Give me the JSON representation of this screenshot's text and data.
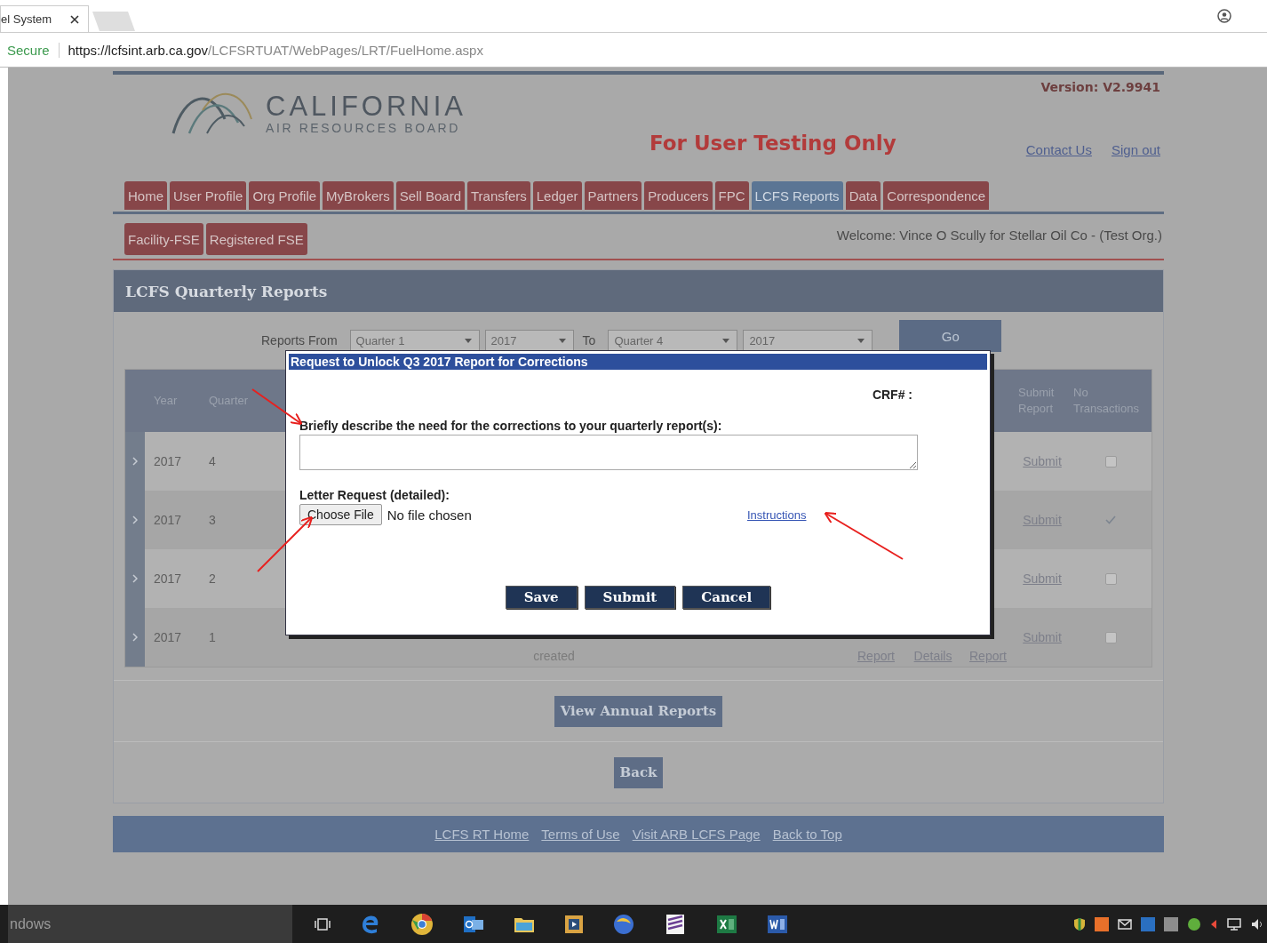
{
  "browser": {
    "tab_title": "el System",
    "secure": "Secure",
    "url_host": "https://lcfsint.arb.ca.gov",
    "url_path": "/LCFSRTUAT/WebPages/LRT/FuelHome.aspx"
  },
  "header": {
    "logo_name": "CALIFORNIA",
    "logo_sub": "AIR RESOURCES BOARD",
    "version": "Version: V2.9941",
    "banner": "For User Testing Only",
    "links": [
      "Contact Us",
      "Sign out"
    ]
  },
  "nav_tabs": [
    {
      "label": "Home",
      "selected": false
    },
    {
      "label": "User Profile",
      "selected": false
    },
    {
      "label": "Org Profile",
      "selected": false
    },
    {
      "label": "MyBrokers",
      "selected": false
    },
    {
      "label": "Sell Board",
      "selected": false
    },
    {
      "label": "Transfers",
      "selected": false
    },
    {
      "label": "Ledger",
      "selected": false
    },
    {
      "label": "Partners",
      "selected": false
    },
    {
      "label": "Producers",
      "selected": false
    },
    {
      "label": "FPC",
      "selected": false
    },
    {
      "label": "LCFS Reports",
      "selected": true
    },
    {
      "label": "Data",
      "selected": false
    },
    {
      "label": "Correspondence",
      "selected": false
    }
  ],
  "sub_tabs": [
    {
      "label": "Facility-FSE",
      "selected": false
    },
    {
      "label": "Registered FSE",
      "selected": false
    }
  ],
  "welcome": "Welcome: Vince O Scully for Stellar Oil Co - (Test Org.)",
  "section_title": "LCFS Quarterly Reports",
  "filter": {
    "from_label": "Reports From",
    "from_quarter": "Quarter 1",
    "from_year": "2017",
    "to_label": "To",
    "to_quarter": "Quarter 4",
    "to_year": "2017",
    "go": "Go"
  },
  "table": {
    "columns": [
      "Year",
      "Quarter",
      "Submit Report",
      "No Transactions"
    ],
    "rows": [
      {
        "year": "2017",
        "quarter": "4",
        "submit": "Submit",
        "no_transactions": false,
        "notes": []
      },
      {
        "year": "2017",
        "quarter": "3",
        "submit": "Submit",
        "no_transactions": true,
        "notes": []
      },
      {
        "year": "2017",
        "quarter": "2",
        "submit": "Submit",
        "no_transactions": false,
        "notes": []
      },
      {
        "year": "2017",
        "quarter": "1",
        "submit": "Submit",
        "no_transactions": false,
        "notes": [
          "created",
          "Report",
          "Details",
          "Report"
        ]
      }
    ]
  },
  "view_annual": "View Annual Reports",
  "back": "Back",
  "footer_links": [
    "LCFS RT Home",
    "Terms of Use",
    "Visit ARB LCFS Page",
    "Back to Top"
  ],
  "dialog": {
    "title": "Request to Unlock Q3 2017 Report for Corrections",
    "crf_label": "CRF# :",
    "prompt": "Briefly describe the need for the corrections to your quarterly report(s):",
    "letter_label": "Letter Request (detailed):",
    "choose_file": "Choose File",
    "no_file": "No file chosen",
    "instructions": "Instructions",
    "buttons": [
      "Save",
      "Submit",
      "Cancel"
    ]
  },
  "taskbar": {
    "search": "ndows"
  }
}
